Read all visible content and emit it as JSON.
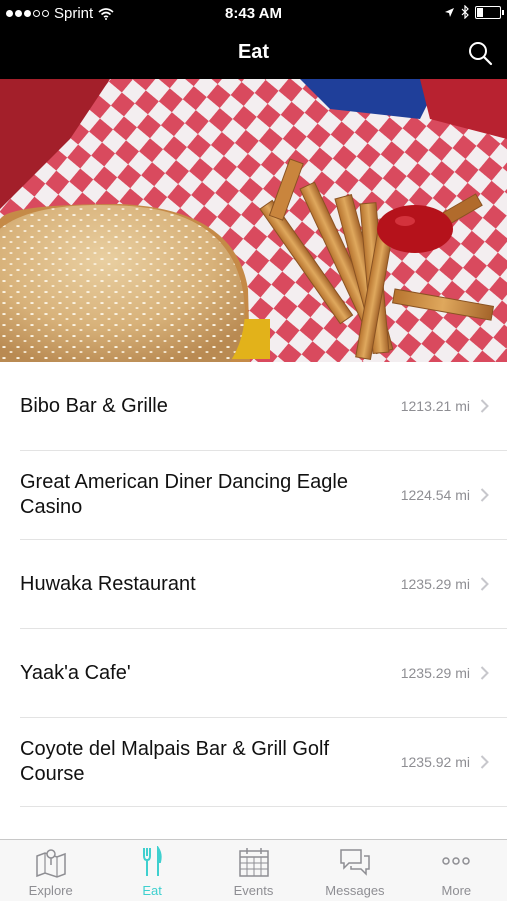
{
  "status_bar": {
    "carrier": "Sprint",
    "time": "8:43 AM",
    "signal_bars_filled": 3,
    "signal_bars_total": 5,
    "battery_level": 0.25
  },
  "nav": {
    "title": "Eat",
    "search_icon": "search-icon"
  },
  "hero": {
    "icon": "burger-and-fries-photo"
  },
  "restaurants": [
    {
      "name": "Bibo Bar & Grille",
      "distance": "1213.21 mi"
    },
    {
      "name": "Great American Diner Dancing Eagle Casino",
      "distance": "1224.54 mi"
    },
    {
      "name": "Huwaka Restaurant",
      "distance": "1235.29 mi"
    },
    {
      "name": "Yaak'a  Cafe'",
      "distance": "1235.29 mi"
    },
    {
      "name": "Coyote del Malpais Bar & Grill  Golf Course",
      "distance": "1235.92 mi"
    }
  ],
  "tabs": [
    {
      "label": "Explore",
      "icon": "map-icon",
      "active": false
    },
    {
      "label": "Eat",
      "icon": "fork-knife-icon",
      "active": true
    },
    {
      "label": "Events",
      "icon": "calendar-icon",
      "active": false
    },
    {
      "label": "Messages",
      "icon": "chat-bubbles-icon",
      "active": false
    },
    {
      "label": "More",
      "icon": "more-dots-icon",
      "active": false
    }
  ],
  "colors": {
    "accent": "#3fd0cf",
    "inactive": "#8e8e93",
    "bar_background": "#000000"
  }
}
